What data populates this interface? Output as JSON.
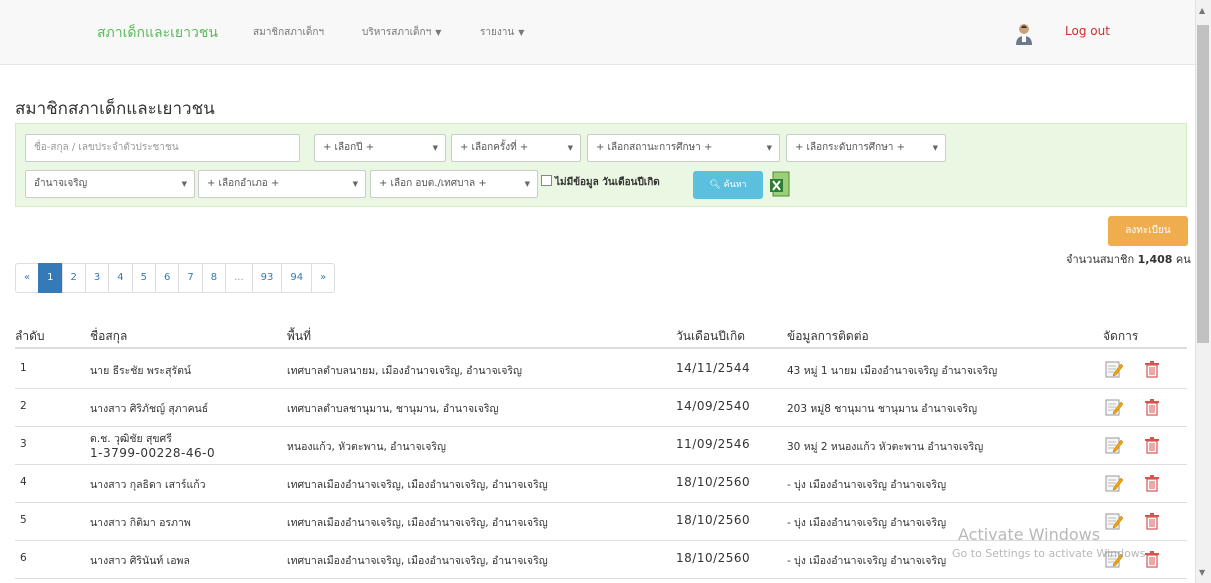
{
  "navbar": {
    "brand": "สภาเด็กและเยาวชน",
    "links": [
      {
        "label": "สมาชิกสภาเด็กฯ",
        "dropdown": false
      },
      {
        "label": "บริหารสภาเด็กฯ",
        "dropdown": true
      },
      {
        "label": "รายงาน",
        "dropdown": true
      }
    ],
    "logout": "Log out"
  },
  "page_title": "สมาชิกสภาเด็กและเยาวชน",
  "filters": {
    "search_placeholder": "ชื่อ-สกุล / เลขประจำตัวประชาชน",
    "year": "+ เลือกปี +",
    "round": "+ เลือกครั้งที่ +",
    "study_status": "+ เลือกสถานะการศึกษา +",
    "study_level": "+ เลือกระดับการศึกษา +",
    "province": "อำนาจเจริญ",
    "district": "+ เลือกอำเภอ +",
    "subdistrict": "+ เลือก อบต./เทศบาล +",
    "no_birthdate_label": "ไม่มีข้อมูล วันเดือนปีเกิด",
    "search_button": "ค้นหา"
  },
  "register_button": "ลงทะเบียน",
  "member_count": {
    "label": "จำนวนสมาชิก",
    "value": "1,408",
    "unit": "คน"
  },
  "pagination": [
    "«",
    "1",
    "2",
    "3",
    "4",
    "5",
    "6",
    "7",
    "8",
    "...",
    "93",
    "94",
    "»"
  ],
  "pagination_active": "1",
  "table": {
    "headers": [
      "ลำดับ",
      "ชื่อสกุล",
      "พื้นที่",
      "วันเดือนปีเกิด",
      "ข้อมูลการติดต่อ",
      "จัดการ"
    ],
    "rows": [
      {
        "no": "1",
        "name": "นาย ธีระชัย พระสุรัตน์",
        "name2": "",
        "area": "เทศบาลตำบลนายม, เมืองอำนาจเจริญ, อำนาจเจริญ",
        "birth": "14/11/2544",
        "contact": "43 หมู่ 1 นายม เมืองอำนาจเจริญ อำนาจเจริญ"
      },
      {
        "no": "2",
        "name": "นางสาว ศิริภัชญ์ สุภาคนธ์",
        "name2": "",
        "area": "เทศบาลตำบลชานุมาน, ชานุมาน, อำนาจเจริญ",
        "birth": "14/09/2540",
        "contact": "203 หมู่8 ชานุมาน ชานุมาน อำนาจเจริญ"
      },
      {
        "no": "3",
        "name": "ด.ช. วุฒิชัย สุขศรี",
        "name2": "1-3799-00228-46-0",
        "area": "หนองแก้ว, หัวตะพาน, อำนาจเจริญ",
        "birth": "11/09/2546",
        "contact": "30 หมู่ 2 หนองแก้ว หัวตะพาน อำนาจเจริญ"
      },
      {
        "no": "4",
        "name": "นางสาว กุลธิดา เสาร์แก้ว",
        "name2": "",
        "area": "เทศบาลเมืองอำนาจเจริญ, เมืองอำนาจเจริญ, อำนาจเจริญ",
        "birth": "18/10/2560",
        "contact": "- บุ่ง เมืองอำนาจเจริญ อำนาจเจริญ"
      },
      {
        "no": "5",
        "name": "นางสาว กิติมา อรภาพ",
        "name2": "",
        "area": "เทศบาลเมืองอำนาจเจริญ, เมืองอำนาจเจริญ, อำนาจเจริญ",
        "birth": "18/10/2560",
        "contact": "- บุ่ง เมืองอำนาจเจริญ อำนาจเจริญ"
      },
      {
        "no": "6",
        "name": "นางสาว ศิรินันท์ เอพล",
        "name2": "",
        "area": "เทศบาลเมืองอำนาจเจริญ, เมืองอำนาจเจริญ, อำนาจเจริญ",
        "birth": "18/10/2560",
        "contact": "- บุ่ง เมืองอำนาจเจริญ อำนาจเจริญ"
      }
    ]
  },
  "watermark": {
    "line1": "Activate Windows",
    "line2": "Go to Settings to activate Windows."
  },
  "colors": {
    "brand": "#5cb85c",
    "logout": "#c9302c",
    "primary": "#337ab7",
    "info": "#5bc0de",
    "warning": "#f0ad4e",
    "panel": "#eaf7e2"
  }
}
